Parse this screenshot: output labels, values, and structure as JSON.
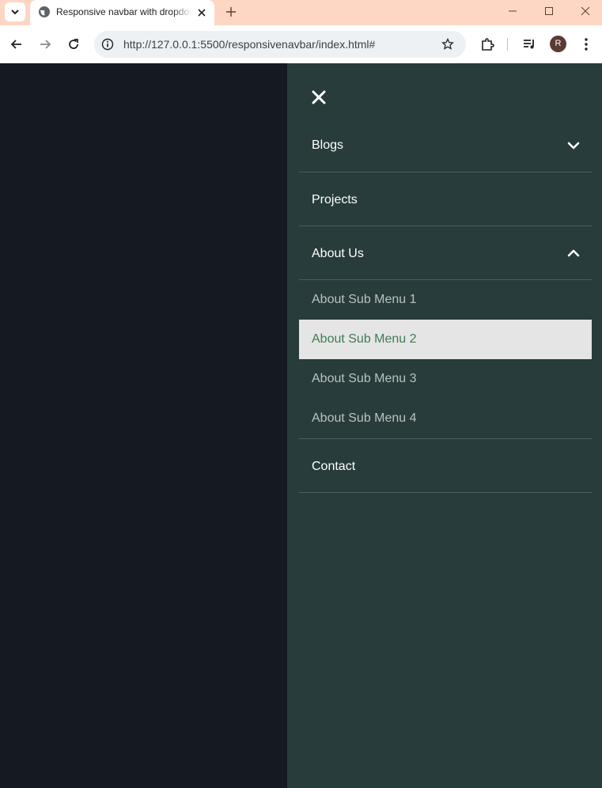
{
  "browser": {
    "tab_title": "Responsive navbar with dropdown menu",
    "url": "http://127.0.0.1:5500/responsivenavbar/index.html#",
    "profile_initial": "R",
    "colors": {
      "titlebar": "#fdd7c4",
      "toolbar": "#ffffff"
    }
  },
  "nav": {
    "close_icon": "close-icon",
    "items": [
      {
        "label": "Blogs",
        "icon": "chevron-down-icon"
      },
      {
        "label": "Projects"
      },
      {
        "label": "About Us",
        "icon": "chevron-up-icon",
        "submenu": [
          {
            "label": "About Sub Menu 1"
          },
          {
            "label": "About Sub Menu 2",
            "hovered": true
          },
          {
            "label": "About Sub Menu 3"
          },
          {
            "label": "About Sub Menu 4"
          }
        ]
      },
      {
        "label": "Contact"
      }
    ],
    "colors": {
      "drawer": "#273c3b",
      "overlay": "#141a20",
      "hover_bg": "#e5e5e5",
      "hover_text": "#3f7c52"
    }
  }
}
